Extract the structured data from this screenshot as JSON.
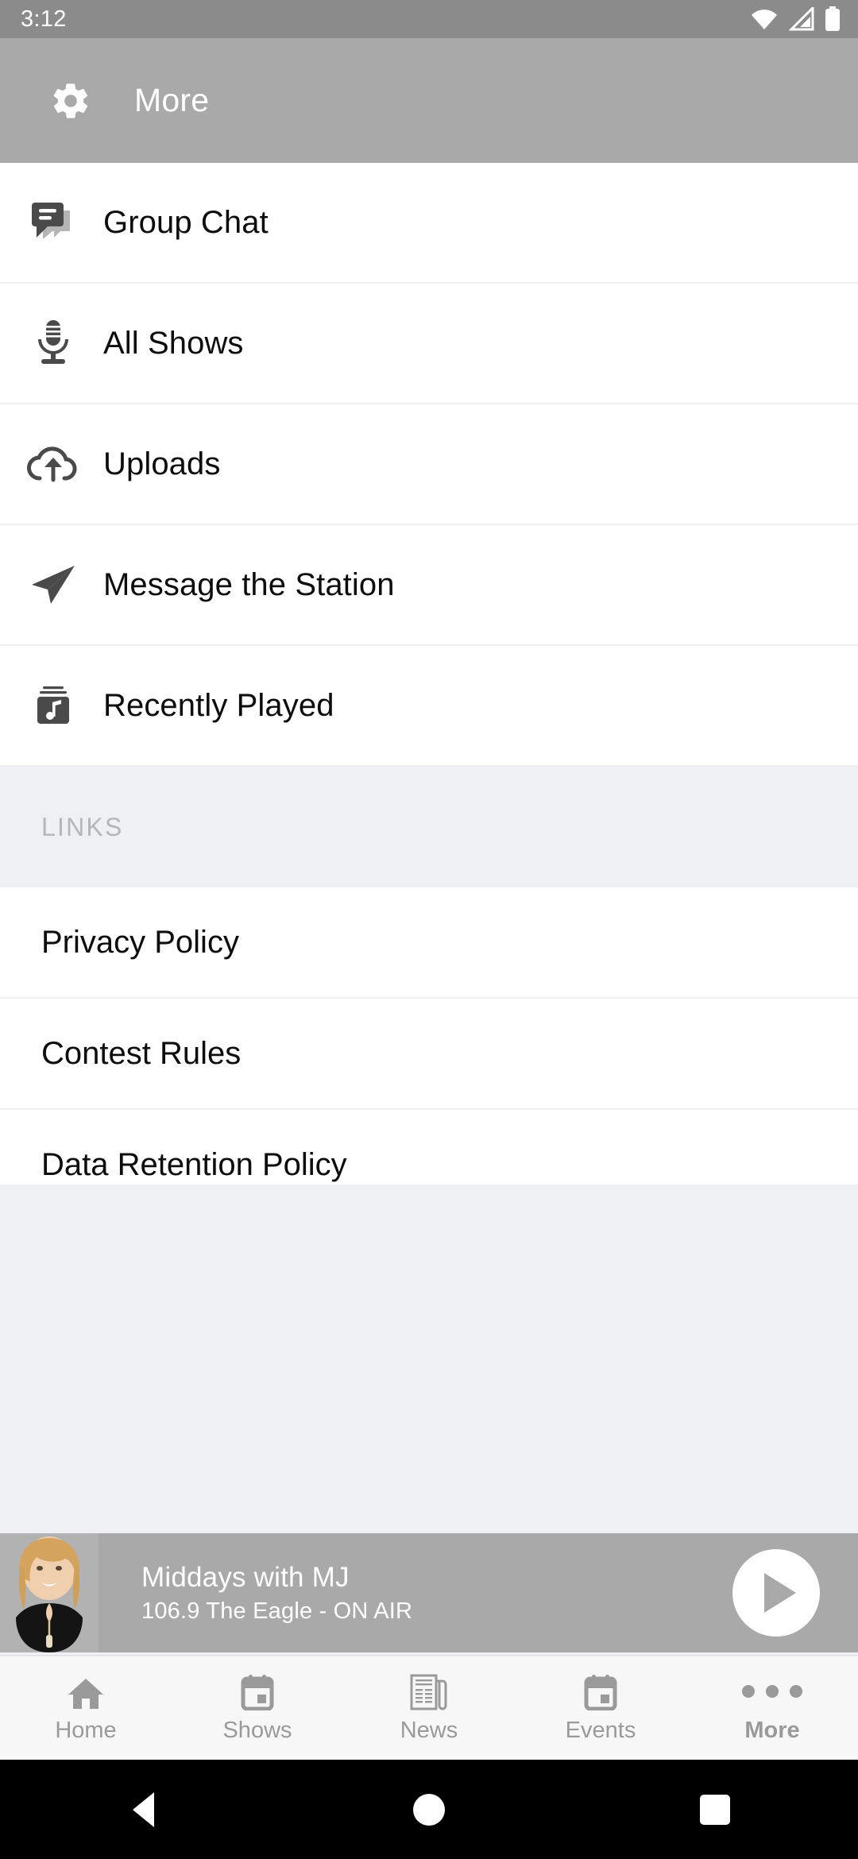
{
  "status_bar": {
    "time": "3:12",
    "icons": [
      "wifi-icon",
      "cellular-signal-icon",
      "battery-icon"
    ]
  },
  "app_bar": {
    "icon": "gear-icon",
    "title": "More"
  },
  "menu": {
    "items": [
      {
        "label": "Group Chat",
        "icon": "chat-bubbles-icon"
      },
      {
        "label": "All Shows",
        "icon": "microphone-icon"
      },
      {
        "label": "Uploads",
        "icon": "cloud-upload-icon"
      },
      {
        "label": "Message the Station",
        "icon": "paper-plane-icon"
      },
      {
        "label": "Recently Played",
        "icon": "music-album-icon"
      }
    ]
  },
  "links_section": {
    "header": "LINKS",
    "items": [
      {
        "label": "Privacy Policy"
      },
      {
        "label": "Contest Rules"
      },
      {
        "label": "Data Retention Policy"
      }
    ]
  },
  "player": {
    "artwork": "host-photo",
    "title": "Middays with MJ",
    "subtitle": "106.9 The Eagle - ON AIR",
    "action_icon": "play-icon"
  },
  "tab_bar": {
    "active": "More",
    "tabs": [
      {
        "label": "Home",
        "icon": "home-icon"
      },
      {
        "label": "Shows",
        "icon": "calendar-icon"
      },
      {
        "label": "News",
        "icon": "newspaper-icon"
      },
      {
        "label": "Events",
        "icon": "calendar-icon"
      },
      {
        "label": "More",
        "icon": "ellipsis-icon"
      }
    ]
  },
  "system_nav": {
    "back": "back-triangle-icon",
    "home": "home-circle-icon",
    "recents": "recents-square-icon"
  },
  "colors": {
    "status_bar": "#8b8b8b",
    "app_bar": "#a9a9a9",
    "page_bg": "#eff0f3",
    "row_bg": "#ffffff",
    "text": "#0d0d0d",
    "muted": "#9a9a9a",
    "player_bar": "#a9a9a9"
  }
}
